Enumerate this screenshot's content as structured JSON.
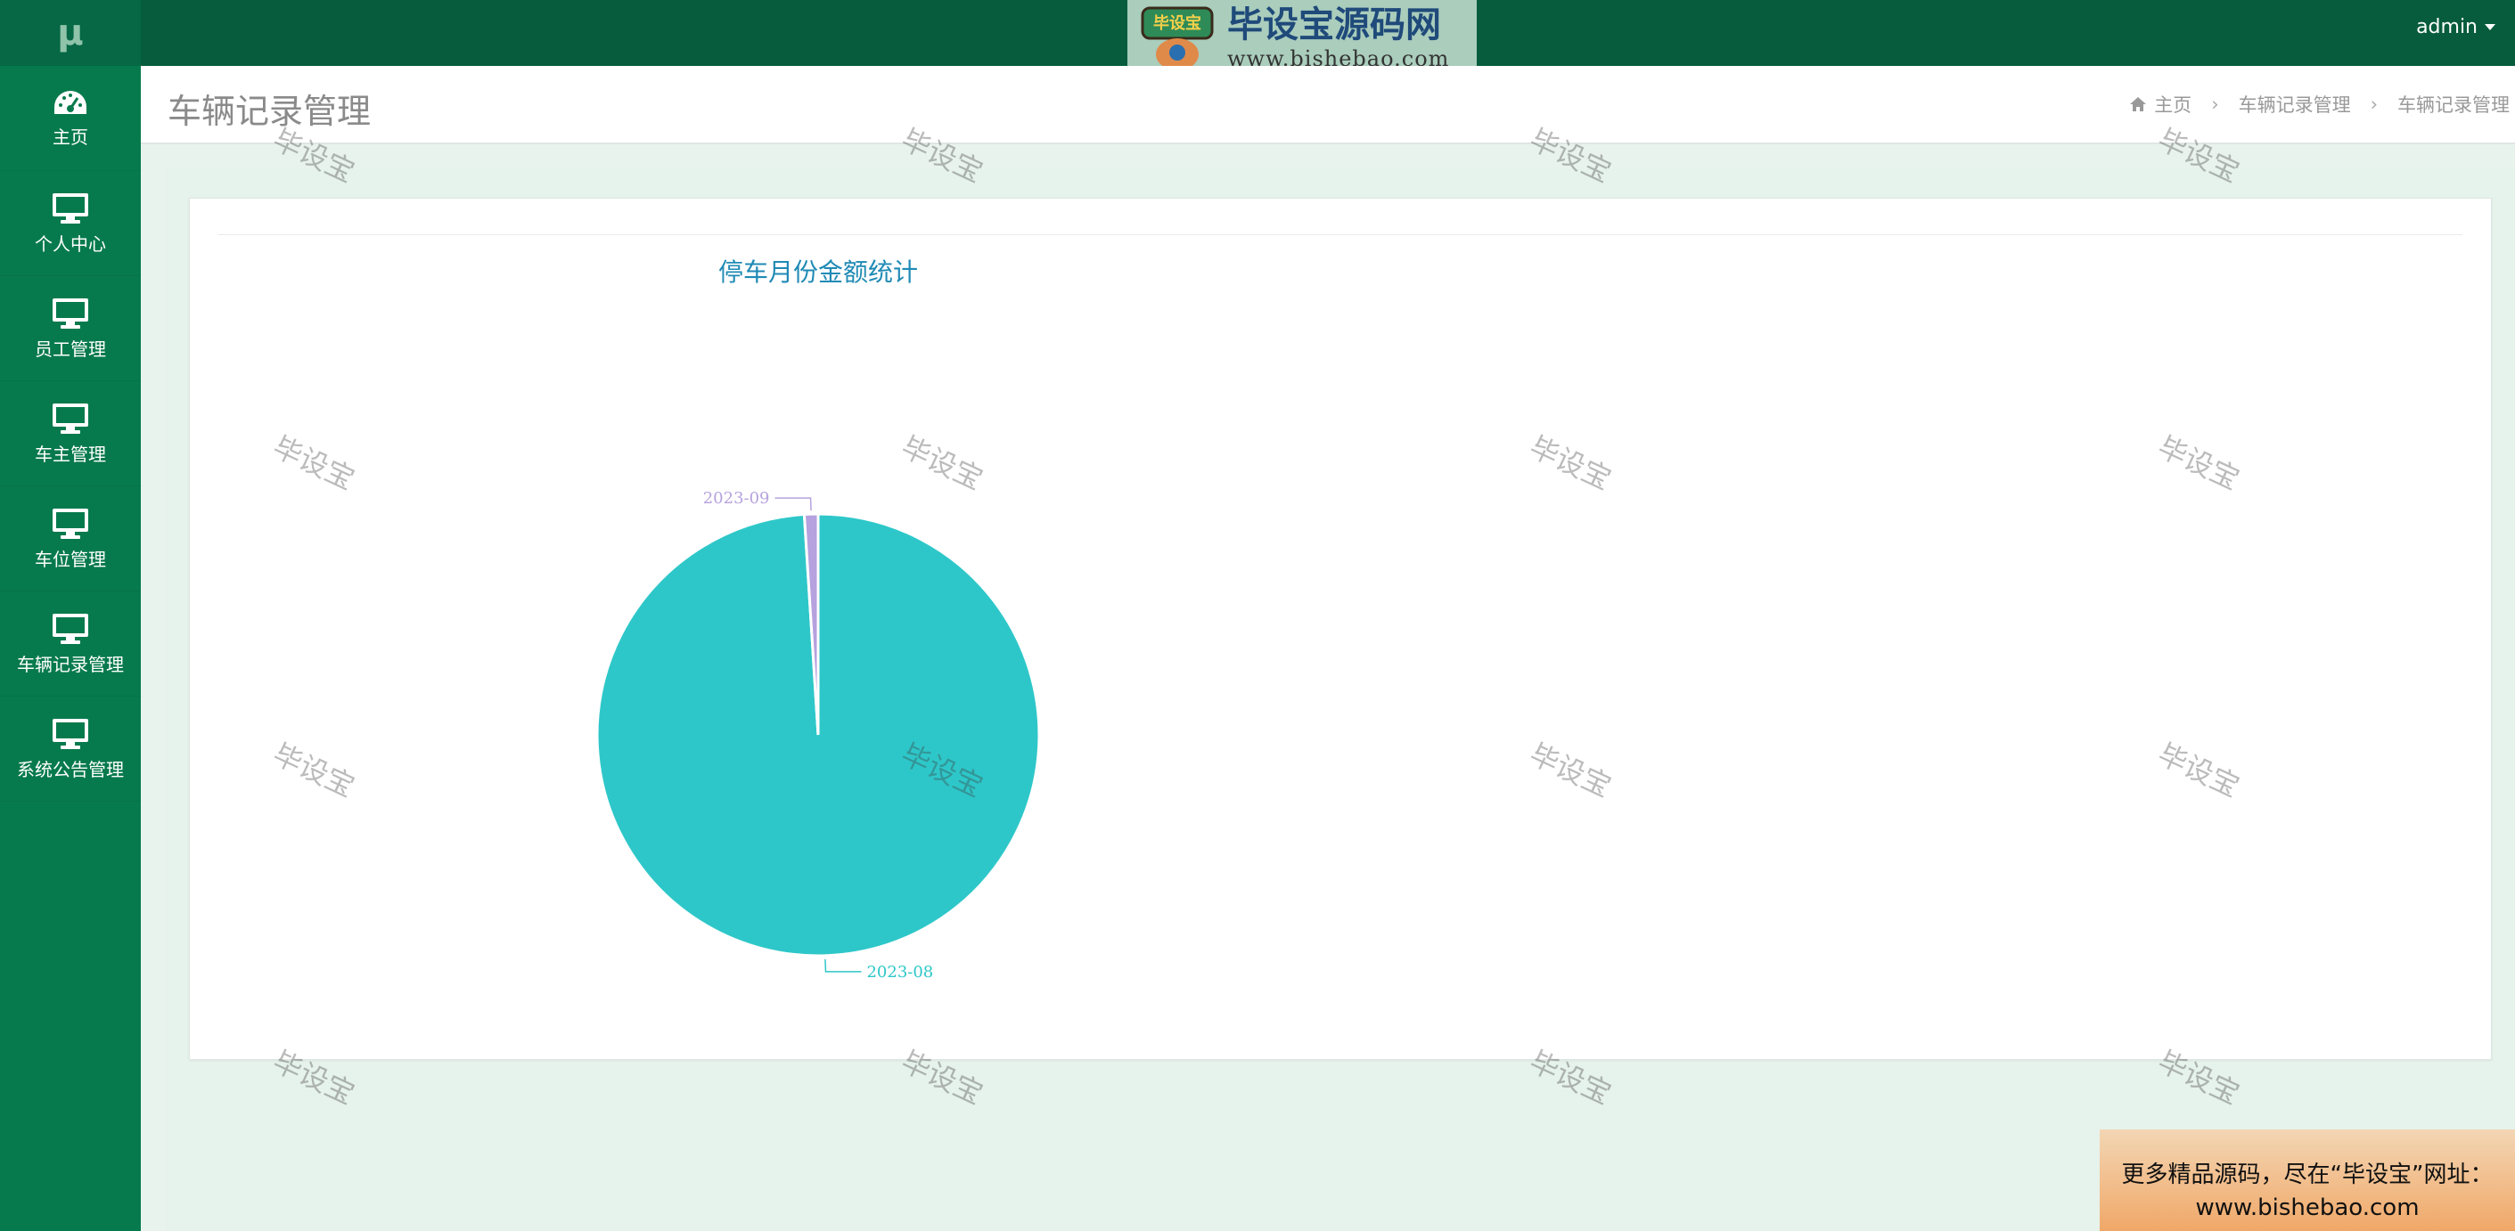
{
  "sidebar": {
    "brand": "µ",
    "items": [
      {
        "label": "主页",
        "icon": "dashboard-icon"
      },
      {
        "label": "个人中心",
        "icon": "monitor-icon"
      },
      {
        "label": "员工管理",
        "icon": "monitor-icon"
      },
      {
        "label": "车主管理",
        "icon": "monitor-icon"
      },
      {
        "label": "车位管理",
        "icon": "monitor-icon"
      },
      {
        "label": "车辆记录管理",
        "icon": "monitor-icon"
      },
      {
        "label": "系统公告管理",
        "icon": "monitor-icon"
      }
    ]
  },
  "topbar": {
    "user": "admin",
    "logo_title": "毕设宝源码网",
    "logo_badge": "毕设宝",
    "logo_url": "www.bishebao.com"
  },
  "header": {
    "title": "车辆记录管理",
    "breadcrumb": [
      "主页",
      "车辆记录管理",
      "车辆记录管理"
    ]
  },
  "watermark": "毕设宝",
  "promo": {
    "line1": "更多精品源码，尽在“毕设宝”网址：",
    "line2": "www.bishebao.com"
  },
  "colors": {
    "sidebar": "#077a4d",
    "topbar": "#065c3c",
    "pie_main": "#2ec7c9",
    "pie_minor": "#b6a2de",
    "title": "#1f8ab5"
  },
  "chart_data": {
    "type": "pie",
    "title": "停车月份金额统计",
    "categories": [
      "2023-08",
      "2023-09"
    ],
    "values": [
      99,
      1
    ],
    "colors": [
      "#2ec7c9",
      "#b6a2de"
    ]
  }
}
